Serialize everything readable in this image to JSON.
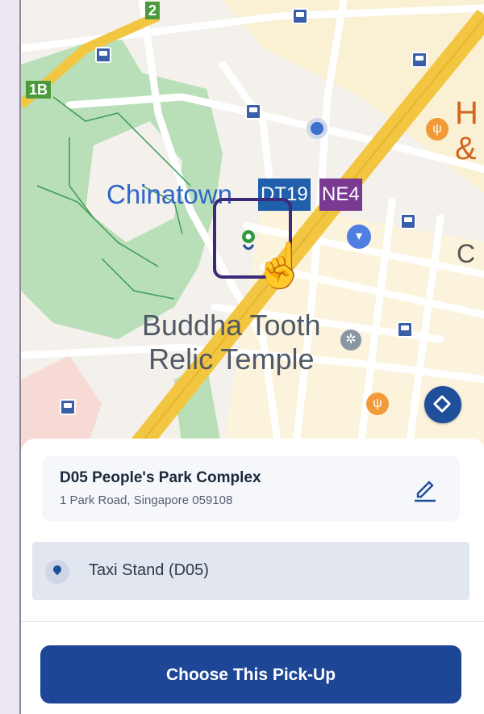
{
  "map": {
    "labels": {
      "chinatown": "Chinatown",
      "dt_code": "DT19",
      "ne_code": "NE4",
      "buddha_line1": "Buddha Tooth",
      "buddha_line2": "Relic Temple",
      "route_1b": "1B",
      "route_2": "2",
      "side_h": "H",
      "side_amp": "&",
      "side_c": "C"
    },
    "icons": [
      "bus-stop-icon",
      "restaurant-icon",
      "shopping-icon",
      "temple-icon",
      "my-location-icon",
      "recenter-icon",
      "pickup-pin-icon",
      "tap-hand-icon"
    ],
    "colors": {
      "expressway": "#f2c641",
      "park": "#b9dfb9",
      "road": "#ffffff",
      "brand": "#1e4696"
    }
  },
  "pickup": {
    "title": "D05 People's Park Complex",
    "address": "1 Park Road, Singapore 059108",
    "edit_icon": "edit-pencil-icon"
  },
  "stand": {
    "label": "Taxi Stand (D05)",
    "icon": "location-pin-icon"
  },
  "cta": {
    "label": "Choose This Pick-Up"
  }
}
